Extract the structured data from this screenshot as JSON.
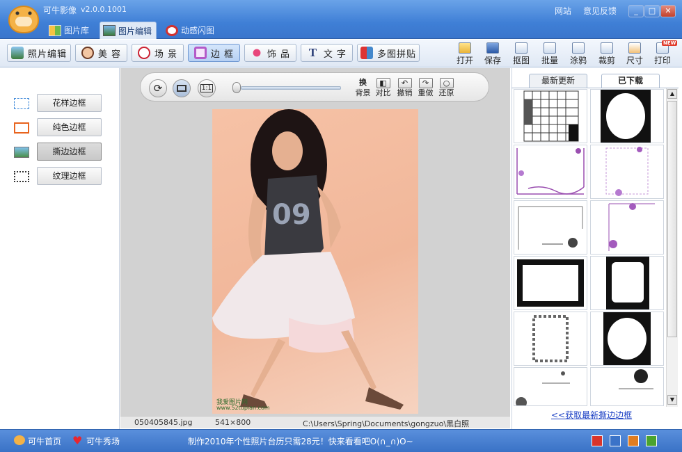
{
  "app": {
    "name": "可牛影像",
    "version": "v2.0.0.1001",
    "links": [
      "网站",
      "意见反馈"
    ]
  },
  "window_buttons": [
    "minimize",
    "maximize",
    "close"
  ],
  "main_tabs": [
    {
      "label": "图片库",
      "icon": "grid-icon"
    },
    {
      "label": "图片编辑",
      "icon": "image-edit-icon"
    },
    {
      "label": "动感闪图",
      "icon": "flash-icon"
    }
  ],
  "active_main_tab": "图片编辑",
  "toolbar": {
    "tabs": [
      {
        "label": "照片编辑",
        "icon": "photo-edit-icon"
      },
      {
        "label": "美 容",
        "icon": "face-icon"
      },
      {
        "label": "场 景",
        "icon": "scene-icon"
      },
      {
        "label": "边 框",
        "icon": "frame-icon"
      },
      {
        "label": "饰 品",
        "icon": "ribbon-icon"
      },
      {
        "label": "文 字",
        "icon": "text-icon"
      },
      {
        "label": "多图拼贴",
        "icon": "collage-icon"
      }
    ],
    "active": "边 框",
    "actions": [
      {
        "label": "打开",
        "icon": "open-folder-icon"
      },
      {
        "label": "保存",
        "icon": "save-icon"
      },
      {
        "label": "抠图",
        "icon": "cutout-icon"
      },
      {
        "label": "批量",
        "icon": "batch-icon"
      },
      {
        "label": "涂鸦",
        "icon": "pen-icon"
      },
      {
        "label": "裁剪",
        "icon": "crop-icon"
      },
      {
        "label": "尺寸",
        "icon": "resize-icon"
      },
      {
        "label": "打印",
        "icon": "print-icon",
        "badge": "NEW"
      }
    ]
  },
  "frame_types": [
    {
      "label": "花样边框",
      "icon": "dotted-frame-icon"
    },
    {
      "label": "纯色边框",
      "icon": "solid-frame-icon"
    },
    {
      "label": "撕边边框",
      "icon": "landscape-frame-icon"
    },
    {
      "label": "纹理边框",
      "icon": "texture-frame-icon"
    }
  ],
  "active_frame_type": "撕边边框",
  "canvas_controls": {
    "left_buttons": [
      "rotate-icon",
      "fit-screen-icon",
      "actual-size-icon"
    ],
    "actual_size_label": "1:1",
    "right_buttons": [
      {
        "label": "背景",
        "glyph": "换"
      },
      {
        "label": "对比",
        "glyph": "◧"
      },
      {
        "label": "撤销",
        "glyph": "↶"
      },
      {
        "label": "重做",
        "glyph": "↷"
      },
      {
        "label": "还原",
        "glyph": "○"
      }
    ]
  },
  "photo": {
    "watermark_line1": "我爱图片网",
    "watermark_line2": "www.52tupian.com",
    "shirt_text": "09"
  },
  "file_info": {
    "filename": "050405845.jpg",
    "dimensions": "541×800",
    "path": "C:\\Users\\Spring\\Documents\\gongzuo\\黑白照"
  },
  "right_panel": {
    "tabs": [
      "最新更新",
      "已下载"
    ],
    "active_tab": "已下载",
    "thumbnails": 12,
    "get_more_link": "<<获取最新撕边边框"
  },
  "statusbar": {
    "home": "可牛首页",
    "show": "可牛秀场",
    "message": "制作2010年个性照片台历只需28元！快来看看吧O(∩_∩)O~",
    "icons": [
      "red-icon",
      "blue-doc-icon",
      "orange-icon",
      "green-icon"
    ]
  },
  "colors": {
    "title_bar": "#3f7fd6",
    "accent": "#6f98d2",
    "link": "#1a3fc4",
    "canvas_bg": "#d2d2d2"
  }
}
